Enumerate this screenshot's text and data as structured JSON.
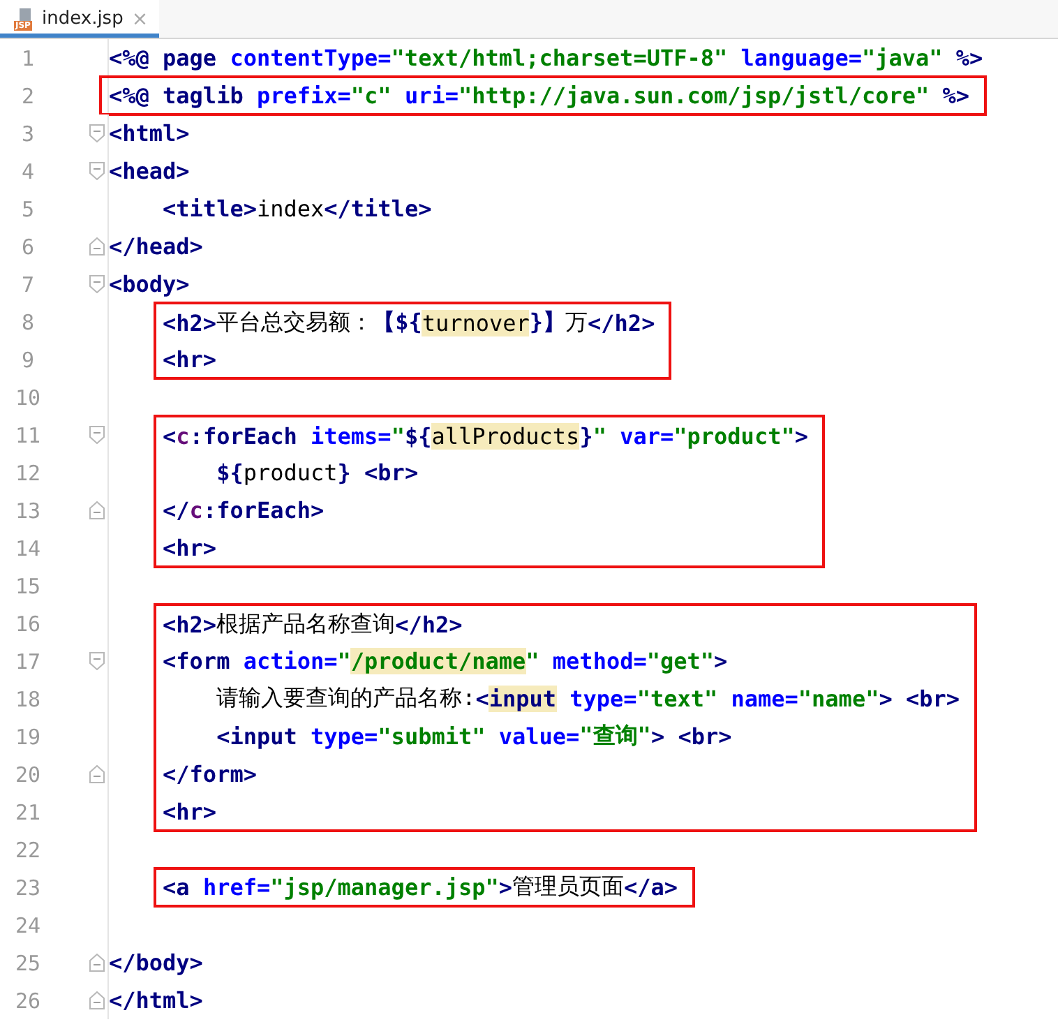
{
  "tab": {
    "icon_label": "JSP",
    "title": "index.jsp",
    "close": "×",
    "selected": true
  },
  "blocks": [
    {
      "boxed": false,
      "lines": [
        {
          "number": "1",
          "kind": "flush",
          "fold_open": false,
          "fold_close": false,
          "tokens": [
            {
              "kind": "tag",
              "text": "<%@ page "
            },
            {
              "kind": "attr",
              "text": "contentType="
            },
            {
              "kind": "string",
              "text": "\"text/html;charset=UTF-8\""
            },
            {
              "kind": "attr",
              "text": " language="
            },
            {
              "kind": "string",
              "text": "\"java\""
            },
            {
              "kind": "tag",
              "text": " %>"
            }
          ]
        }
      ]
    },
    {
      "boxed": true,
      "lines": [
        {
          "number": "2",
          "kind": "flush",
          "fold_open": false,
          "fold_close": false,
          "tokens": [
            {
              "kind": "tag",
              "text": "<%@ taglib "
            },
            {
              "kind": "attr",
              "text": "prefix="
            },
            {
              "kind": "string",
              "text": "\"c\""
            },
            {
              "kind": "attr",
              "text": " uri="
            },
            {
              "kind": "string",
              "text": "\"http://java.sun.com/jsp/jstl/core\""
            },
            {
              "kind": "tag",
              "text": " %>"
            }
          ]
        }
      ]
    },
    {
      "boxed": false,
      "lines": [
        {
          "number": "3",
          "kind": "flush",
          "fold_open": true,
          "fold_close": false,
          "tokens": [
            {
              "kind": "tag",
              "text": "<html>"
            }
          ]
        },
        {
          "number": "4",
          "kind": "flush",
          "fold_open": true,
          "fold_close": false,
          "tokens": [
            {
              "kind": "tag",
              "text": "<head>"
            }
          ]
        },
        {
          "number": "5",
          "kind": "inner",
          "fold_open": false,
          "fold_close": false,
          "tokens": [
            {
              "kind": "tag",
              "text": "<title>"
            },
            {
              "kind": "text",
              "text": "index"
            },
            {
              "kind": "tag",
              "text": "</title>"
            }
          ]
        },
        {
          "number": "6",
          "kind": "flush",
          "fold_open": false,
          "fold_close": true,
          "tokens": [
            {
              "kind": "tag",
              "text": "</head>"
            }
          ]
        },
        {
          "number": "7",
          "kind": "flush",
          "fold_open": true,
          "fold_close": false,
          "tokens": [
            {
              "kind": "tag",
              "text": "<body>"
            }
          ]
        }
      ]
    },
    {
      "boxed": true,
      "lines": [
        {
          "number": "8",
          "kind": "inner",
          "fold_open": false,
          "fold_close": false,
          "tokens": [
            {
              "kind": "tag",
              "text": "<h2>"
            },
            {
              "kind": "text",
              "text": "平台总交易额："
            },
            {
              "kind": "el",
              "text": "【${"
            },
            {
              "kind": "hl-text",
              "text": "turnover"
            },
            {
              "kind": "el",
              "text": "}】"
            },
            {
              "kind": "text",
              "text": "万"
            },
            {
              "kind": "tag",
              "text": "</h2>"
            }
          ]
        },
        {
          "number": "9",
          "kind": "inner",
          "fold_open": false,
          "fold_close": false,
          "tokens": [
            {
              "kind": "tag",
              "text": "<hr>"
            }
          ]
        }
      ]
    },
    {
      "boxed": false,
      "lines": [
        {
          "number": "10",
          "kind": "flush",
          "fold_open": false,
          "fold_close": false
        }
      ]
    },
    {
      "boxed": true,
      "lines": [
        {
          "number": "11",
          "kind": "inner",
          "fold_open": true,
          "fold_close": false,
          "tokens": [
            {
              "kind": "tag",
              "text": "<"
            },
            {
              "kind": "prefix",
              "text": "c"
            },
            {
              "kind": "tag",
              "text": ":forEach "
            },
            {
              "kind": "attr",
              "text": "items="
            },
            {
              "kind": "string",
              "text": "\""
            },
            {
              "kind": "el",
              "text": "${"
            },
            {
              "kind": "hl-text",
              "text": "allProducts"
            },
            {
              "kind": "el",
              "text": "}"
            },
            {
              "kind": "string",
              "text": "\""
            },
            {
              "kind": "attr",
              "text": " var="
            },
            {
              "kind": "string",
              "text": "\"product\""
            },
            {
              "kind": "tag",
              "text": ">"
            }
          ]
        },
        {
          "number": "12",
          "kind": "nested",
          "fold_open": false,
          "fold_close": false,
          "tokens": [
            {
              "kind": "el",
              "text": "${"
            },
            {
              "kind": "text",
              "text": "product"
            },
            {
              "kind": "el",
              "text": "}"
            },
            {
              "kind": "tag",
              "text": " <br>"
            }
          ]
        },
        {
          "number": "13",
          "kind": "inner",
          "fold_open": false,
          "fold_close": true,
          "tokens": [
            {
              "kind": "tag",
              "text": "</"
            },
            {
              "kind": "prefix",
              "text": "c"
            },
            {
              "kind": "tag",
              "text": ":forEach>"
            }
          ]
        },
        {
          "number": "14",
          "kind": "inner",
          "fold_open": false,
          "fold_close": false,
          "tokens": [
            {
              "kind": "tag",
              "text": "<hr>"
            }
          ]
        }
      ]
    },
    {
      "boxed": false,
      "lines": [
        {
          "number": "15",
          "kind": "flush",
          "fold_open": false,
          "fold_close": false
        }
      ]
    },
    {
      "boxed": true,
      "lines": [
        {
          "number": "16",
          "kind": "inner",
          "fold_open": false,
          "fold_close": false,
          "tokens": [
            {
              "kind": "tag",
              "text": "<h2>"
            },
            {
              "kind": "text",
              "text": "根据产品名称查询"
            },
            {
              "kind": "tag",
              "text": "</h2>"
            }
          ]
        },
        {
          "number": "17",
          "kind": "inner",
          "fold_open": true,
          "fold_close": false,
          "tokens": [
            {
              "kind": "tag",
              "text": "<form "
            },
            {
              "kind": "attr",
              "text": "action="
            },
            {
              "kind": "string",
              "text": "\""
            },
            {
              "kind": "hl-string",
              "text": "/product/name"
            },
            {
              "kind": "string",
              "text": "\""
            },
            {
              "kind": "attr",
              "text": " method="
            },
            {
              "kind": "string",
              "text": "\"get\""
            },
            {
              "kind": "tag",
              "text": ">"
            }
          ]
        },
        {
          "number": "18",
          "kind": "nested",
          "fold_open": false,
          "fold_close": false,
          "tokens": [
            {
              "kind": "text",
              "text": "请输入要查询的产品名称:"
            },
            {
              "kind": "tag",
              "text": "<"
            },
            {
              "kind": "hl-tag",
              "text": "input"
            },
            {
              "kind": "attr",
              "text": " type="
            },
            {
              "kind": "string",
              "text": "\"text\""
            },
            {
              "kind": "attr",
              "text": " name="
            },
            {
              "kind": "string",
              "text": "\"name\""
            },
            {
              "kind": "tag",
              "text": ">"
            },
            {
              "kind": "tag",
              "text": " <br>"
            }
          ]
        },
        {
          "number": "19",
          "kind": "nested",
          "fold_open": false,
          "fold_close": false,
          "tokens": [
            {
              "kind": "tag",
              "text": "<input "
            },
            {
              "kind": "attr",
              "text": "type="
            },
            {
              "kind": "string",
              "text": "\"submit\""
            },
            {
              "kind": "attr",
              "text": " value="
            },
            {
              "kind": "string",
              "text": "\"查询\""
            },
            {
              "kind": "tag",
              "text": ">"
            },
            {
              "kind": "tag",
              "text": " <br>"
            }
          ]
        },
        {
          "number": "20",
          "kind": "inner",
          "fold_open": false,
          "fold_close": true,
          "tokens": [
            {
              "kind": "tag",
              "text": "</form>"
            }
          ]
        },
        {
          "number": "21",
          "kind": "inner",
          "fold_open": false,
          "fold_close": false,
          "tokens": [
            {
              "kind": "tag",
              "text": "<hr>"
            }
          ]
        }
      ]
    },
    {
      "boxed": false,
      "lines": [
        {
          "number": "22",
          "kind": "flush",
          "fold_open": false,
          "fold_close": false
        }
      ]
    },
    {
      "boxed": true,
      "lines": [
        {
          "number": "23",
          "kind": "inner",
          "fold_open": false,
          "fold_close": false,
          "tokens": [
            {
              "kind": "tag",
              "text": "<a "
            },
            {
              "kind": "attr",
              "text": "href="
            },
            {
              "kind": "string",
              "text": "\"jsp/manager.jsp\""
            },
            {
              "kind": "tag",
              "text": ">"
            },
            {
              "kind": "text",
              "text": "管理员页面"
            },
            {
              "kind": "tag",
              "text": "</a>"
            }
          ]
        }
      ]
    },
    {
      "boxed": false,
      "lines": [
        {
          "number": "24",
          "kind": "flush",
          "fold_open": false,
          "fold_close": false
        },
        {
          "number": "25",
          "kind": "flush",
          "fold_open": false,
          "fold_close": true,
          "tokens": [
            {
              "kind": "tag",
              "text": "</body>"
            }
          ]
        },
        {
          "number": "26",
          "kind": "flush",
          "fold_open": false,
          "fold_close": true,
          "tokens": [
            {
              "kind": "tag",
              "text": "</html>"
            }
          ]
        }
      ]
    }
  ]
}
